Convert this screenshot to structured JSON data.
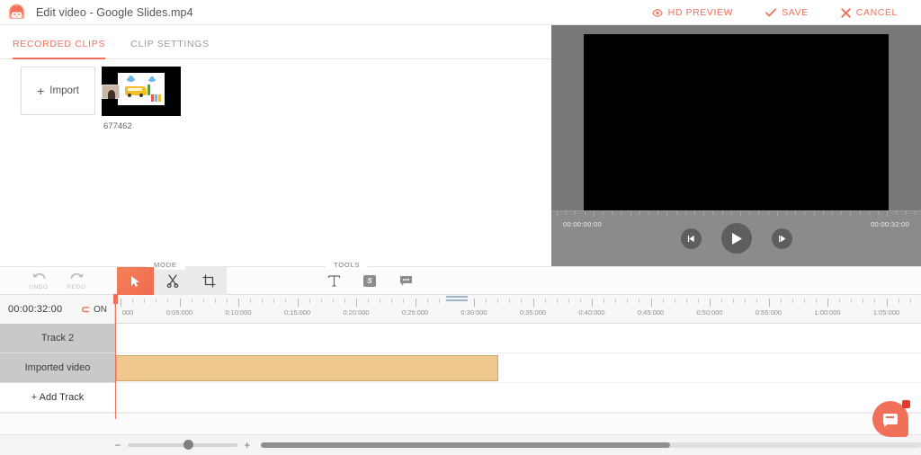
{
  "titlebar": {
    "logo_icon": "robot-mascot-icon",
    "title": "Edit video - Google Slides.mp4",
    "actions": [
      {
        "label": "HD PREVIEW",
        "icon": "eye-icon"
      },
      {
        "label": "SAVE",
        "icon": "check-icon"
      },
      {
        "label": "CANCEL",
        "icon": "close-icon"
      }
    ]
  },
  "tabs": [
    {
      "label": "RECORDED CLIPS",
      "active": true
    },
    {
      "label": "CLIP SETTINGS",
      "active": false
    }
  ],
  "clips_panel": {
    "import_label": "Import",
    "import_icon": "plus-icon",
    "clips": [
      {
        "name": "677462",
        "thumbnail": "school-bus-slide-thumbnail"
      }
    ]
  },
  "preview": {
    "start_timecode": "00:00:00:00",
    "end_timecode": "00:00:32:00",
    "controls": [
      {
        "name": "step-back-button",
        "icon": "step-backward-icon"
      },
      {
        "name": "play-button",
        "icon": "play-icon"
      },
      {
        "name": "step-forward-button",
        "icon": "step-forward-icon"
      }
    ]
  },
  "toolbar": {
    "undo_label": "UNDO",
    "redo_label": "REDO",
    "mode_group_label": "MODE",
    "tools_group_label": "TOOLS",
    "mode_buttons": [
      {
        "name": "select-tool",
        "icon": "cursor-arrow-icon",
        "active": true
      },
      {
        "name": "cut-tool",
        "icon": "scissors-icon",
        "active": false
      },
      {
        "name": "crop-tool",
        "icon": "crop-icon",
        "active": false
      }
    ],
    "tool_buttons": [
      {
        "name": "text-tool",
        "icon": "text-t-icon",
        "label": "T"
      },
      {
        "name": "sticker-tool",
        "icon": "sticker-s-icon",
        "label": "S"
      },
      {
        "name": "callout-tool",
        "icon": "speech-bubble-icon"
      }
    ]
  },
  "timeline": {
    "timecode": "00:00:32:00",
    "snap_icon": "magnet-icon",
    "snap_label": "ON",
    "ruler_labels": [
      "000",
      "0:05:000",
      "0:10:000",
      "0:15:000",
      "0:20:000",
      "0:25:000",
      "0:30:000",
      "0:35:000",
      "0:40:000",
      "0:45:000",
      "0:50:000",
      "0:55:000",
      "1:00:000",
      "1:05:000"
    ],
    "tracks": [
      {
        "label": "Track 2",
        "clips": []
      },
      {
        "label": "Imported video",
        "clips": [
          {
            "name": "imported-video-clip",
            "color": "#edc78c"
          }
        ]
      }
    ],
    "add_track_label": "+ Add Track"
  },
  "bottom_bar": {
    "zoom_out_label": "−",
    "zoom_in_label": "+",
    "zoom_value": 50
  },
  "chat": {
    "icon": "chat-bubble-icon",
    "has_notification": true
  },
  "colors": {
    "accent": "#f1705a",
    "clip": "#edc78c",
    "preview_bg": "#787878",
    "track_label_bg": "#c9c9c9"
  }
}
